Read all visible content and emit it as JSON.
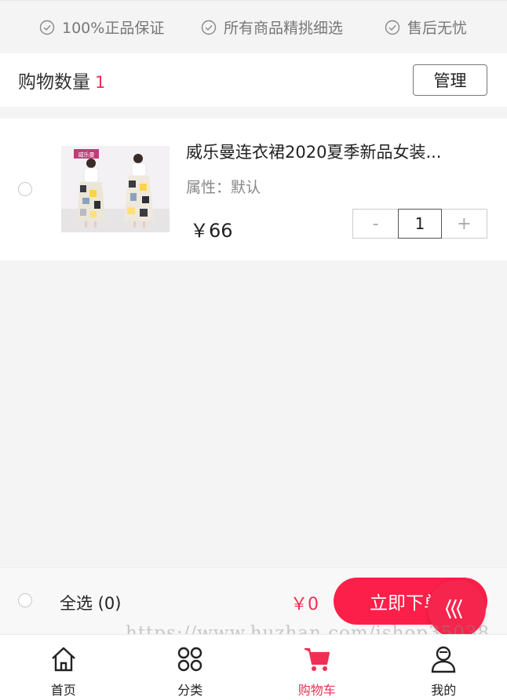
{
  "guarantees": [
    {
      "label": "100%正品保证",
      "icon": "check-circle-icon"
    },
    {
      "label": "所有商品精挑细选",
      "icon": "check-circle-icon"
    },
    {
      "label": "售后无忧",
      "icon": "check-circle-icon"
    }
  ],
  "header": {
    "title": "购物数量",
    "count": "1",
    "manage_label": "管理"
  },
  "cart_items": [
    {
      "title": "威乐曼连衣裙2020夏季新品女装...",
      "attribute": "属性：默认",
      "price": "￥66",
      "quantity": "1",
      "minus": "-",
      "plus": "+",
      "thumb_brand": "威乐曼"
    }
  ],
  "checkout": {
    "select_all_label": "全选 (0)",
    "total": "￥0",
    "buy_label": "立即下单"
  },
  "watermark": "https://www.huzhan.com/ishop35038",
  "tabs": [
    {
      "label": "首页",
      "icon": "home-icon"
    },
    {
      "label": "分类",
      "icon": "category-icon"
    },
    {
      "label": "购物车",
      "icon": "cart-icon",
      "active": true
    },
    {
      "label": "我的",
      "icon": "user-icon"
    }
  ],
  "colors": {
    "accent": "#ef2f54",
    "buy_button": "#fc1f49",
    "background": "#f4f4f4"
  }
}
